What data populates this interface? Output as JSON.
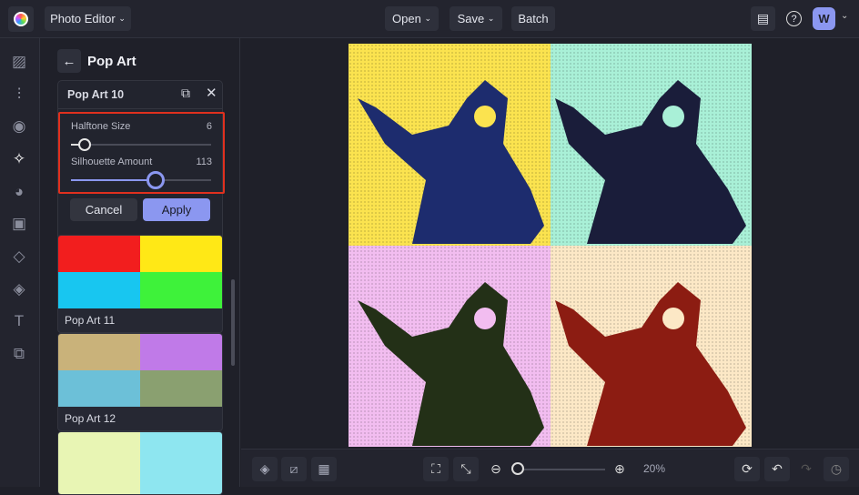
{
  "topbar": {
    "app_menu": "Photo Editor",
    "open": "Open",
    "save": "Save",
    "batch": "Batch",
    "avatar": "W"
  },
  "panel": {
    "title": "Pop Art",
    "effect_name": "Pop Art 10",
    "sliders": [
      {
        "label": "Halftone Size",
        "value": "6",
        "fraction": 0.1
      },
      {
        "label": "Silhouette Amount",
        "value": "113",
        "fraction": 0.6
      }
    ],
    "cancel": "Cancel",
    "apply": "Apply",
    "presets": [
      {
        "label": "Pop Art 11"
      },
      {
        "label": "Pop Art 12"
      }
    ]
  },
  "zoom": {
    "value": "20%",
    "fraction": 0.05
  },
  "colors": {
    "accent": "#8b97f0",
    "highlight": "#e0301e",
    "q1": "#fbe34f",
    "q2": "#a9f0d7",
    "q3": "#f2bdf0",
    "q4": "#fce8c6",
    "ink1": "#1d2c6e",
    "ink2": "#1a1d3a",
    "ink3": "#233017",
    "ink4": "#8c1c12"
  }
}
